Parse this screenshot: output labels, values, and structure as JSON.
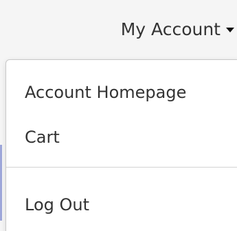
{
  "account_menu": {
    "label": "My Account",
    "toggle_icon": "caret-down-icon",
    "items": [
      {
        "label": "Account Homepage"
      },
      {
        "label": "Cart"
      },
      {
        "label": "Log Out"
      }
    ]
  },
  "colors": {
    "background": "#f5f5f5",
    "menu_background": "#ffffff",
    "text": "#333333",
    "caret": "#111111",
    "divider": "#d3d3d3",
    "left_edge": "#9ea7da"
  }
}
